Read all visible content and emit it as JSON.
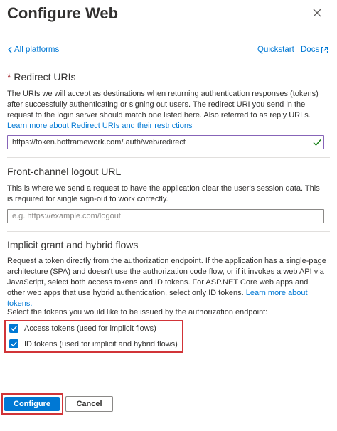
{
  "header": {
    "title": "Configure Web",
    "back_link": "All platforms",
    "quickstart_link": "Quickstart",
    "docs_link": "Docs"
  },
  "redirect": {
    "required_mark": "*",
    "heading": "Redirect URIs",
    "description": "The URIs we will accept as destinations when returning authentication responses (tokens) after successfully authenticating or signing out users. The redirect URI you send in the request to the login server should match one listed here. Also referred to as reply URLs.",
    "learn_more": "Learn more about Redirect URIs and their restrictions",
    "value": "https://token.botframework.com/.auth/web/redirect"
  },
  "logout": {
    "heading": "Front-channel logout URL",
    "description": "This is where we send a request to have the application clear the user's session data. This is required for single sign-out to work correctly.",
    "placeholder": "e.g. https://example.com/logout"
  },
  "implicit": {
    "heading": "Implicit grant and hybrid flows",
    "description": "Request a token directly from the authorization endpoint. If the application has a single-page architecture (SPA) and doesn't use the authorization code flow, or if it invokes a web API via JavaScript, select both access tokens and ID tokens. For ASP.NET Core web apps and other web apps that use hybrid authentication, select only ID tokens.",
    "learn_more": "Learn more about tokens.",
    "select_prompt": "Select the tokens you would like to be issued by the authorization endpoint:",
    "access_tokens_label": "Access tokens (used for implicit flows)",
    "access_tokens_checked": true,
    "id_tokens_label": "ID tokens (used for implicit and hybrid flows)",
    "id_tokens_checked": true
  },
  "footer": {
    "configure_label": "Configure",
    "cancel_label": "Cancel"
  },
  "colors": {
    "accent": "#0078d4",
    "highlight": "#d13438",
    "valid": "#107c10",
    "required": "#a4262c"
  }
}
